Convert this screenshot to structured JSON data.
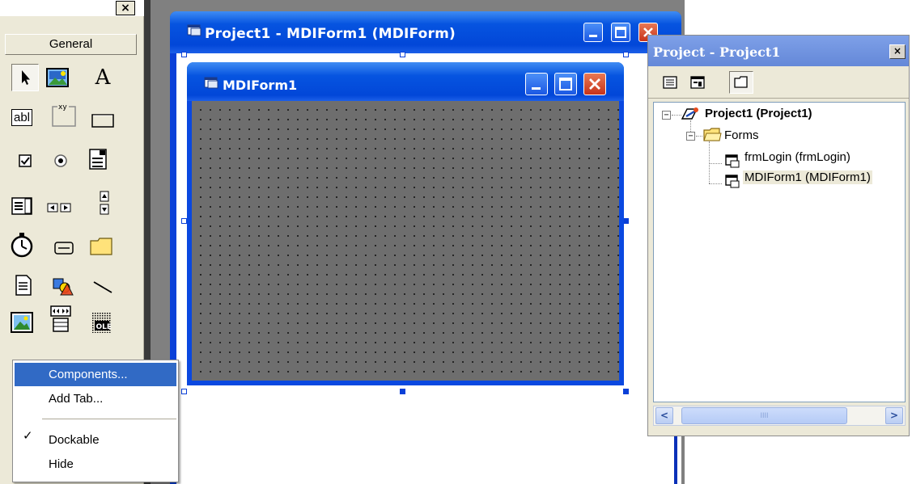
{
  "toolbox": {
    "close_glyph": "×",
    "tab_label": "General",
    "tools": [
      {
        "name": "pointer-icon",
        "glyph": ""
      },
      {
        "name": "picturebox-icon",
        "glyph": ""
      },
      {
        "name": "label-icon",
        "glyph": "A"
      },
      {
        "name": "textbox-icon",
        "glyph": "abl"
      },
      {
        "name": "frame-icon",
        "glyph": "xy"
      },
      {
        "name": "commandbutton-icon",
        "glyph": ""
      },
      {
        "name": "checkbox-icon",
        "glyph": ""
      },
      {
        "name": "optionbutton-icon",
        "glyph": ""
      },
      {
        "name": "combobox-icon",
        "glyph": ""
      },
      {
        "name": "listbox-icon",
        "glyph": ""
      },
      {
        "name": "hscrollbar-icon",
        "glyph": ""
      },
      {
        "name": "vscrollbar-icon",
        "glyph": ""
      },
      {
        "name": "timer-icon",
        "glyph": ""
      },
      {
        "name": "drivelistbox-icon",
        "glyph": ""
      },
      {
        "name": "dirlistbox-icon",
        "glyph": ""
      },
      {
        "name": "filelistbox-icon",
        "glyph": ""
      },
      {
        "name": "shape-icon",
        "glyph": ""
      },
      {
        "name": "line-icon",
        "glyph": ""
      },
      {
        "name": "image-icon",
        "glyph": ""
      },
      {
        "name": "data-control-icon",
        "glyph": ""
      },
      {
        "name": "ole-icon",
        "glyph": "OLE"
      }
    ]
  },
  "project_window": {
    "title": "Project1 - MDIForm1 (MDIForm)"
  },
  "mdiform": {
    "title": "MDIForm1"
  },
  "explorer": {
    "title": "Project - Project1",
    "close_glyph": "×",
    "tree": {
      "root": "Project1 (Project1)",
      "folder": "Forms",
      "items": [
        "frmLogin (frmLogin)",
        "MDIForm1 (MDIForm1)"
      ]
    },
    "scroll_left": "<",
    "scroll_right": ">",
    "scroll_grip": "IIII"
  },
  "context_menu": {
    "items": [
      {
        "label": "Components...",
        "highlighted": true
      },
      {
        "label": "Add Tab...",
        "highlighted": false
      },
      {
        "label": "Dockable",
        "checked": true
      },
      {
        "label": "Hide",
        "highlighted": false
      }
    ],
    "check_glyph": "✓"
  },
  "colors": {
    "titlebar_blue": "#0a40d8",
    "menu_highlight": "#316ac5",
    "grid_gray": "#6e6e6e",
    "toolbox_bg": "#ece9d8"
  }
}
